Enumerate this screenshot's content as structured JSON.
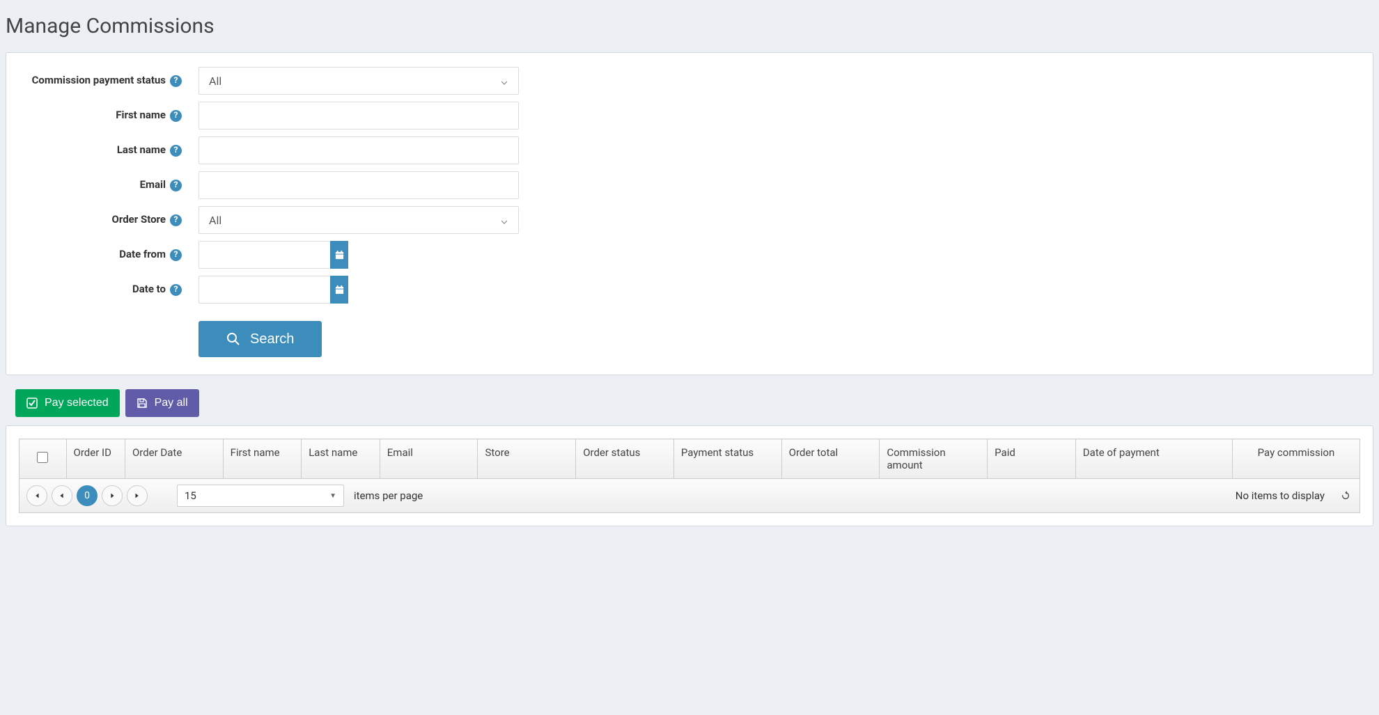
{
  "page": {
    "title": "Manage Commissions"
  },
  "filters": {
    "payment_status": {
      "label": "Commission payment status",
      "value": "All"
    },
    "first_name": {
      "label": "First name",
      "value": ""
    },
    "last_name": {
      "label": "Last name",
      "value": ""
    },
    "email": {
      "label": "Email",
      "value": ""
    },
    "order_store": {
      "label": "Order Store",
      "value": "All"
    },
    "date_from": {
      "label": "Date from",
      "value": ""
    },
    "date_to": {
      "label": "Date to",
      "value": ""
    },
    "search_button": "Search"
  },
  "actions": {
    "pay_selected": "Pay selected",
    "pay_all": "Pay all"
  },
  "grid": {
    "columns": [
      "Order ID",
      "Order Date",
      "First name",
      "Last name",
      "Email",
      "Store",
      "Order status",
      "Payment status",
      "Order total",
      "Commission amount",
      "Paid",
      "Date of payment",
      "Pay commission"
    ],
    "pager": {
      "current_page": "0",
      "page_size": "15",
      "items_per_page_label": "items per page",
      "empty_text": "No items to display"
    }
  }
}
